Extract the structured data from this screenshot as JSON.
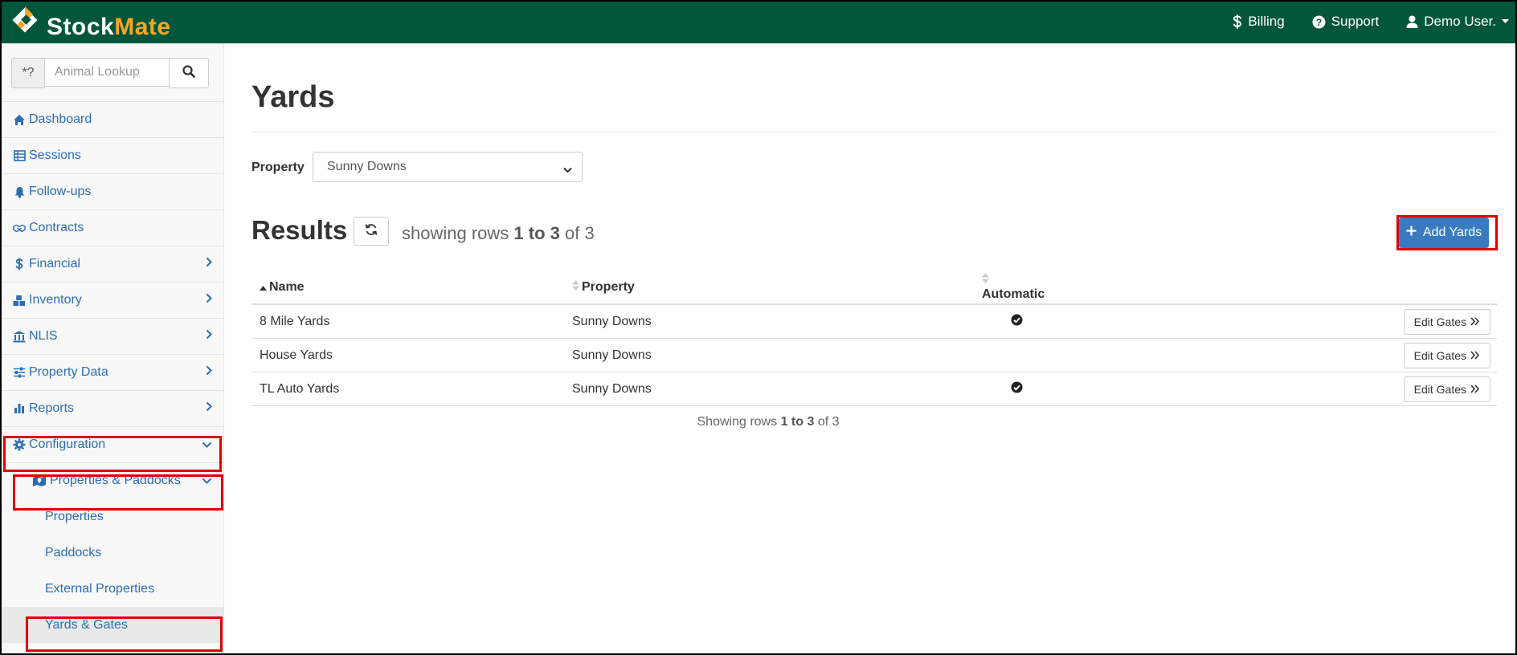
{
  "brand": {
    "part1": "Stock",
    "part2": "Mate",
    "primary_color": "#02573a",
    "accent_color": "#f5a623"
  },
  "topnav": {
    "billing": "Billing",
    "support": "Support",
    "user": "Demo User."
  },
  "search": {
    "prefix": "*?",
    "placeholder": "Animal Lookup"
  },
  "sidebar": {
    "items": [
      {
        "label": "Dashboard",
        "icon": "home-icon"
      },
      {
        "label": "Sessions",
        "icon": "table-icon"
      },
      {
        "label": "Follow-ups",
        "icon": "bell-icon"
      },
      {
        "label": "Contracts",
        "icon": "handshake-icon"
      },
      {
        "label": "Financial",
        "icon": "dollar-icon"
      },
      {
        "label": "Inventory",
        "icon": "boxes-icon"
      },
      {
        "label": "NLIS",
        "icon": "bank-icon"
      },
      {
        "label": "Property Data",
        "icon": "sliders-icon"
      },
      {
        "label": "Reports",
        "icon": "chart-icon"
      },
      {
        "label": "Configuration",
        "icon": "gear-icon"
      }
    ],
    "sub_group": {
      "label": "Properties & Paddocks",
      "icon": "map-icon"
    },
    "sub_items": [
      "Properties",
      "Paddocks",
      "External Properties",
      "Yards & Gates"
    ]
  },
  "page": {
    "title": "Yards",
    "property_label": "Property",
    "property_value": "Sunny Downs",
    "results_title": "Results",
    "showing_prefix": "showing rows",
    "showing_range": "1 to 3",
    "showing_suffix": "of 3",
    "add_button": "Add Yards"
  },
  "table": {
    "columns": [
      "Name",
      "Property",
      "Automatic"
    ],
    "edit_label": "Edit Gates",
    "rows": [
      {
        "name": "8 Mile Yards",
        "property": "Sunny Downs",
        "automatic": true
      },
      {
        "name": "House Yards",
        "property": "Sunny Downs",
        "automatic": false
      },
      {
        "name": "TL Auto Yards",
        "property": "Sunny Downs",
        "automatic": true
      }
    ]
  },
  "footer": {
    "prefix": "Showing rows",
    "range": "1 to 3",
    "suffix": "of 3"
  }
}
